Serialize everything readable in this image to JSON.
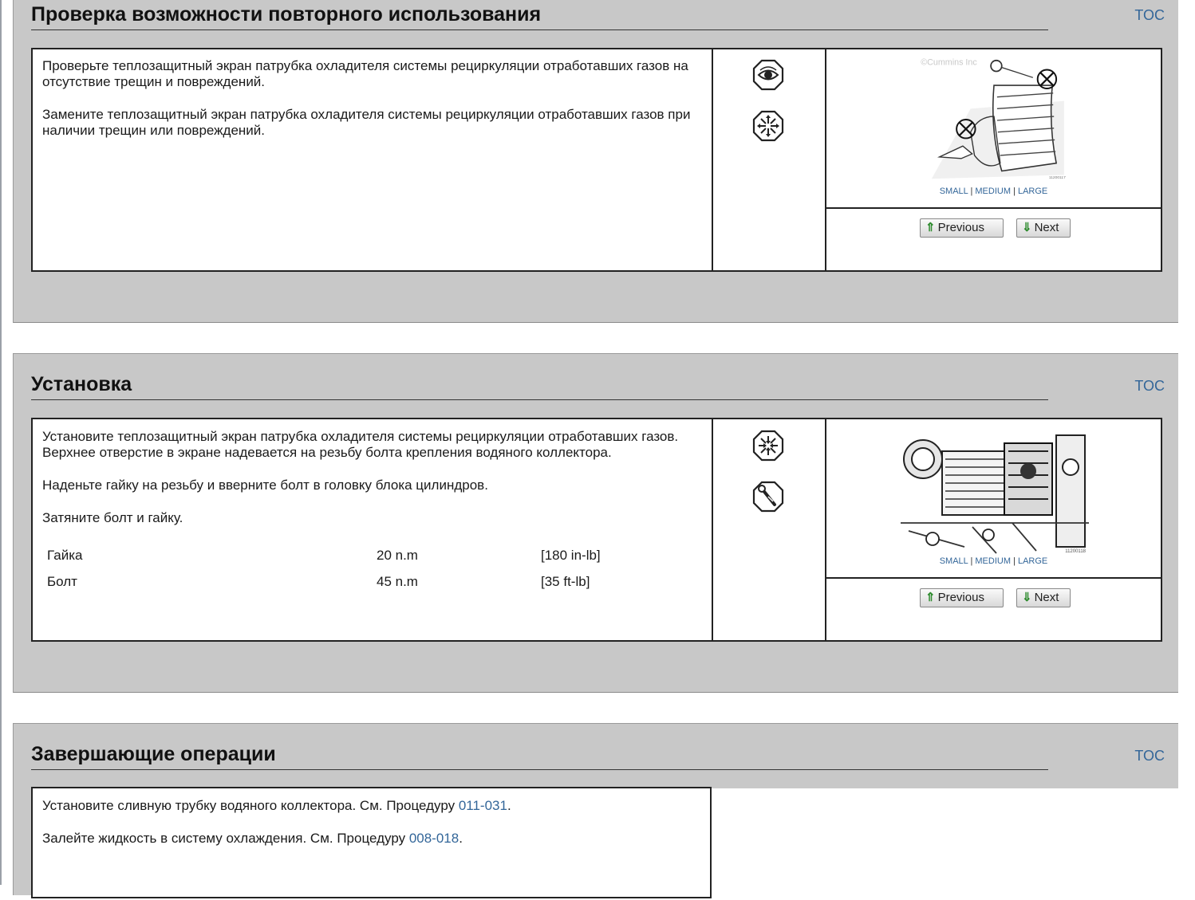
{
  "sections": [
    {
      "title": "Проверка возможности повторного использования",
      "toc": "TOC",
      "paragraphs": [
        "Проверьте теплозащитный экран патрубка охладителя системы рециркуляции отработавших газов на отсутствие трещин и повреждений.",
        "Замените теплозащитный экран патрубка охладителя системы рециркуляции отработавших газов при наличии трещин или повреждений."
      ],
      "icons": [
        "eye-inspect-icon",
        "disassembly-icon"
      ],
      "image_copyright": "©Cummins Inc",
      "image_code": "11200117",
      "size_links": {
        "small": "SMALL",
        "sep": "|",
        "medium": "MEDIUM",
        "large": "LARGE"
      },
      "buttons": {
        "previous": "Previous",
        "next": "Next"
      }
    },
    {
      "title": "Установка",
      "toc": "TOC",
      "paragraphs": [
        "Установите теплозащитный экран патрубка охладителя системы рециркуляции отработавших газов. Верхнее отверстие в экране надевается на резьбу болта крепления водяного коллектора.",
        "Наденьте гайку на резьбу и вверните болт в головку блока цилиндров.",
        "Затяните болт и гайку."
      ],
      "torque": [
        {
          "part": "Гайка",
          "metric": "20 n.m",
          "imperial": "[180 in-lb]"
        },
        {
          "part": "Болт",
          "metric": "45 n.m",
          "imperial": "[35 ft-lb]"
        }
      ],
      "icons": [
        "assembly-icon",
        "torque-wrench-icon"
      ],
      "image_code": "11200118",
      "size_links": {
        "small": "SMALL",
        "sep": "|",
        "medium": "MEDIUM",
        "large": "LARGE"
      },
      "buttons": {
        "previous": "Previous",
        "next": "Next"
      }
    },
    {
      "title": "Завершающие операции",
      "toc": "TOC",
      "lines": [
        {
          "text": "Установите сливную трубку водяного коллектора. См. Процедуру ",
          "link": "011-031",
          "end": "."
        },
        {
          "text": "Залейте жидкость в систему охлаждения. См. Процедуру ",
          "link": "008-018",
          "end": "."
        }
      ]
    }
  ],
  "colors": {
    "panel_bg": "#c8c8c8",
    "link": "#336699",
    "arrow": "#2e8b2e"
  }
}
